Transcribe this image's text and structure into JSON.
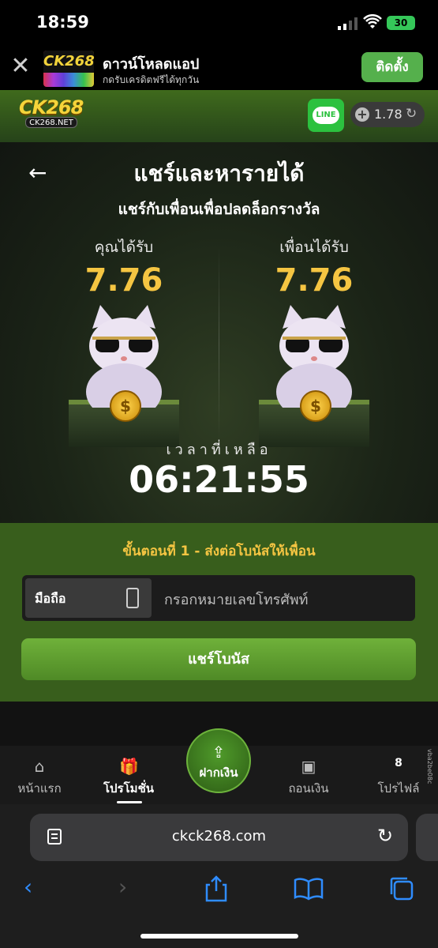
{
  "status_bar": {
    "time": "18:59",
    "battery": "30"
  },
  "app_banner": {
    "logo_text": "CK268",
    "title": "ดาวน์โหลดแอป",
    "subtitle": "กดรับเครดิตฟรีได้ทุกวัน",
    "install_label": "ติดตั้ง"
  },
  "header": {
    "brand": "CK268",
    "brand_sub": "CK268.NET",
    "line_label": "LINE",
    "balance": "1.78"
  },
  "hero": {
    "title": "แชร์และหารายได้",
    "subtitle": "แชร์กับเพื่อนเพื่อปลดล็อกรางวัล",
    "you_label": "คุณได้รับ",
    "you_value": "7.76",
    "friend_label": "เพื่อนได้รับ",
    "friend_value": "7.76",
    "time_left_label": "เวลาที่เหลือ",
    "timer": "06:21:55"
  },
  "step": {
    "title": "ขั้นตอนที่ 1 - ส่งต่อโบนัสให้เพื่อน",
    "phone_prefix": "มือถือ",
    "phone_placeholder": "กรอกหมายเลขโทรศัพท์",
    "share_button": "แชร์โบนัส"
  },
  "nav": {
    "home": "หน้าแรก",
    "promotions": "โปรโมชั่น",
    "deposit": "ฝากเงิน",
    "withdraw": "ถอนเงิน",
    "profile": "โปรไฟล์",
    "profile_level": "8",
    "side_text": "vba2be08c"
  },
  "browser": {
    "url": "ckck268.com"
  },
  "colors": {
    "accent_gold": "#f5c542",
    "brand_green": "#4f8a26",
    "ios_blue": "#2f8cff"
  }
}
